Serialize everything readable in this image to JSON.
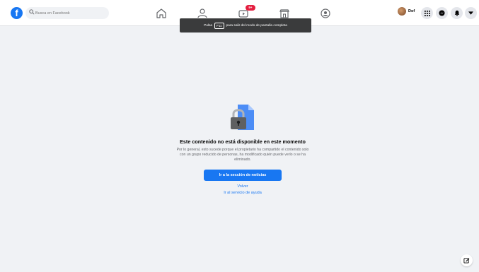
{
  "header": {
    "logo_letter": "f",
    "search_placeholder": "Busca en Facebook",
    "nav": [
      {
        "name": "home-icon"
      },
      {
        "name": "friends-icon"
      },
      {
        "name": "watch-icon",
        "badge": "9+"
      },
      {
        "name": "marketplace-icon"
      },
      {
        "name": "groups-icon"
      }
    ],
    "profile_name": "Dof",
    "right_icons": [
      "menu-grid-icon",
      "messenger-icon",
      "bell-icon",
      "chevron-down-icon"
    ]
  },
  "toast": {
    "prefix": "Pulsa",
    "key": "F11",
    "suffix": "para salir del modo de pantalla completa"
  },
  "content": {
    "title": "Este contenido no está disponible en este momento",
    "description": "Por lo general, esto sucede porque el propietario ha compartido el contenido solo con un grupo reducido de personas, ha modificado quién puede verlo o se ha eliminado.",
    "primary_button": "Ir a la sección de noticias",
    "back_link": "Volver",
    "help_link": "Ir al servicio de ayuda"
  },
  "colors": {
    "brand": "#1877f2",
    "badge": "#e41e3f",
    "background": "#f0f2f5"
  }
}
